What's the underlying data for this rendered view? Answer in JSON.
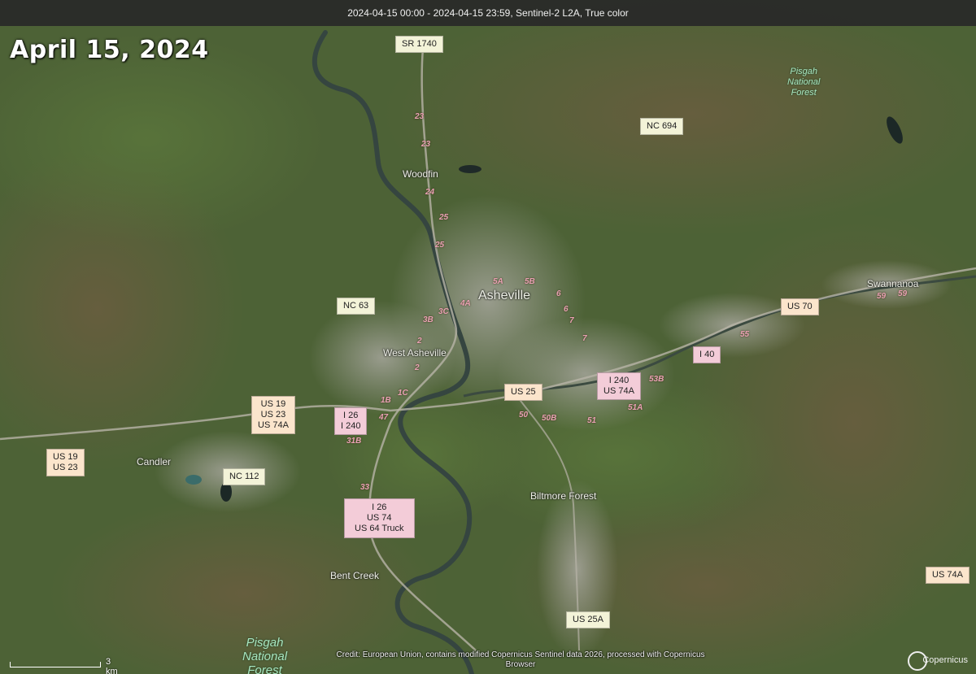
{
  "header": {
    "imagery_info": "2024-04-15 00:00 - 2024-04-15 23:59, Sentinel-2 L2A, True color"
  },
  "overlay": {
    "date_title": "April 15, 2024"
  },
  "road_shields": {
    "sr1740": "SR 1740",
    "nc694": "NC 694",
    "nc63": "NC 63",
    "us70": "US 70",
    "i40": "I 40",
    "i240_us74a": "I 240\nUS 74A",
    "us25": "US 25",
    "us19_23_74a": "US 19\nUS 23\nUS 74A",
    "i26_i240": "I 26\nI 240",
    "us19_23": "US 19\nUS 23",
    "nc112": "NC 112",
    "i26_us74_us64truck": "I 26\nUS 74\nUS 64 Truck",
    "us74a_east": "US 74A",
    "us25a": "US 25A"
  },
  "places": {
    "asheville": "Asheville",
    "woodfin": "Woodfin",
    "west_asheville": "West Asheville",
    "swannanoa": "Swannanoa",
    "candler": "Candler",
    "biltmore_forest": "Biltmore Forest",
    "bent_creek": "Bent Creek",
    "pisgah_ne": "Pisgah\nNational\nForest",
    "pisgah_sw": "Pisgah\nNational\nForest"
  },
  "exits": {
    "e23a": "23",
    "e23b": "23",
    "e24": "24",
    "e25a": "25",
    "e25b": "25",
    "e5a": "5A",
    "e5b": "5B",
    "e4a": "4A",
    "e3b": "3B",
    "e3c": "3C",
    "e6a": "6",
    "e6b": "6",
    "e7a": "7",
    "e7b": "7",
    "e2a": "2",
    "e2b": "2",
    "e1b": "1B",
    "e1c": "1C",
    "e47": "47",
    "e31b": "31B",
    "e33": "33",
    "e50": "50",
    "e50b": "50B",
    "e51": "51",
    "e51a": "51A",
    "e53b": "53B",
    "e55": "55",
    "e59a": "59",
    "e59b": "59"
  },
  "scale": {
    "label": "3 km"
  },
  "credit": {
    "text": "Credit: European Union, contains modified Copernicus Sentinel data 2026, processed with Copernicus Browser"
  },
  "logo": {
    "text": "Copernicus"
  },
  "colors": {
    "vegetation": "#4b6336",
    "urban": "#9a9a92",
    "river": "#3a4a48",
    "forest_brown": "#6e5440"
  }
}
